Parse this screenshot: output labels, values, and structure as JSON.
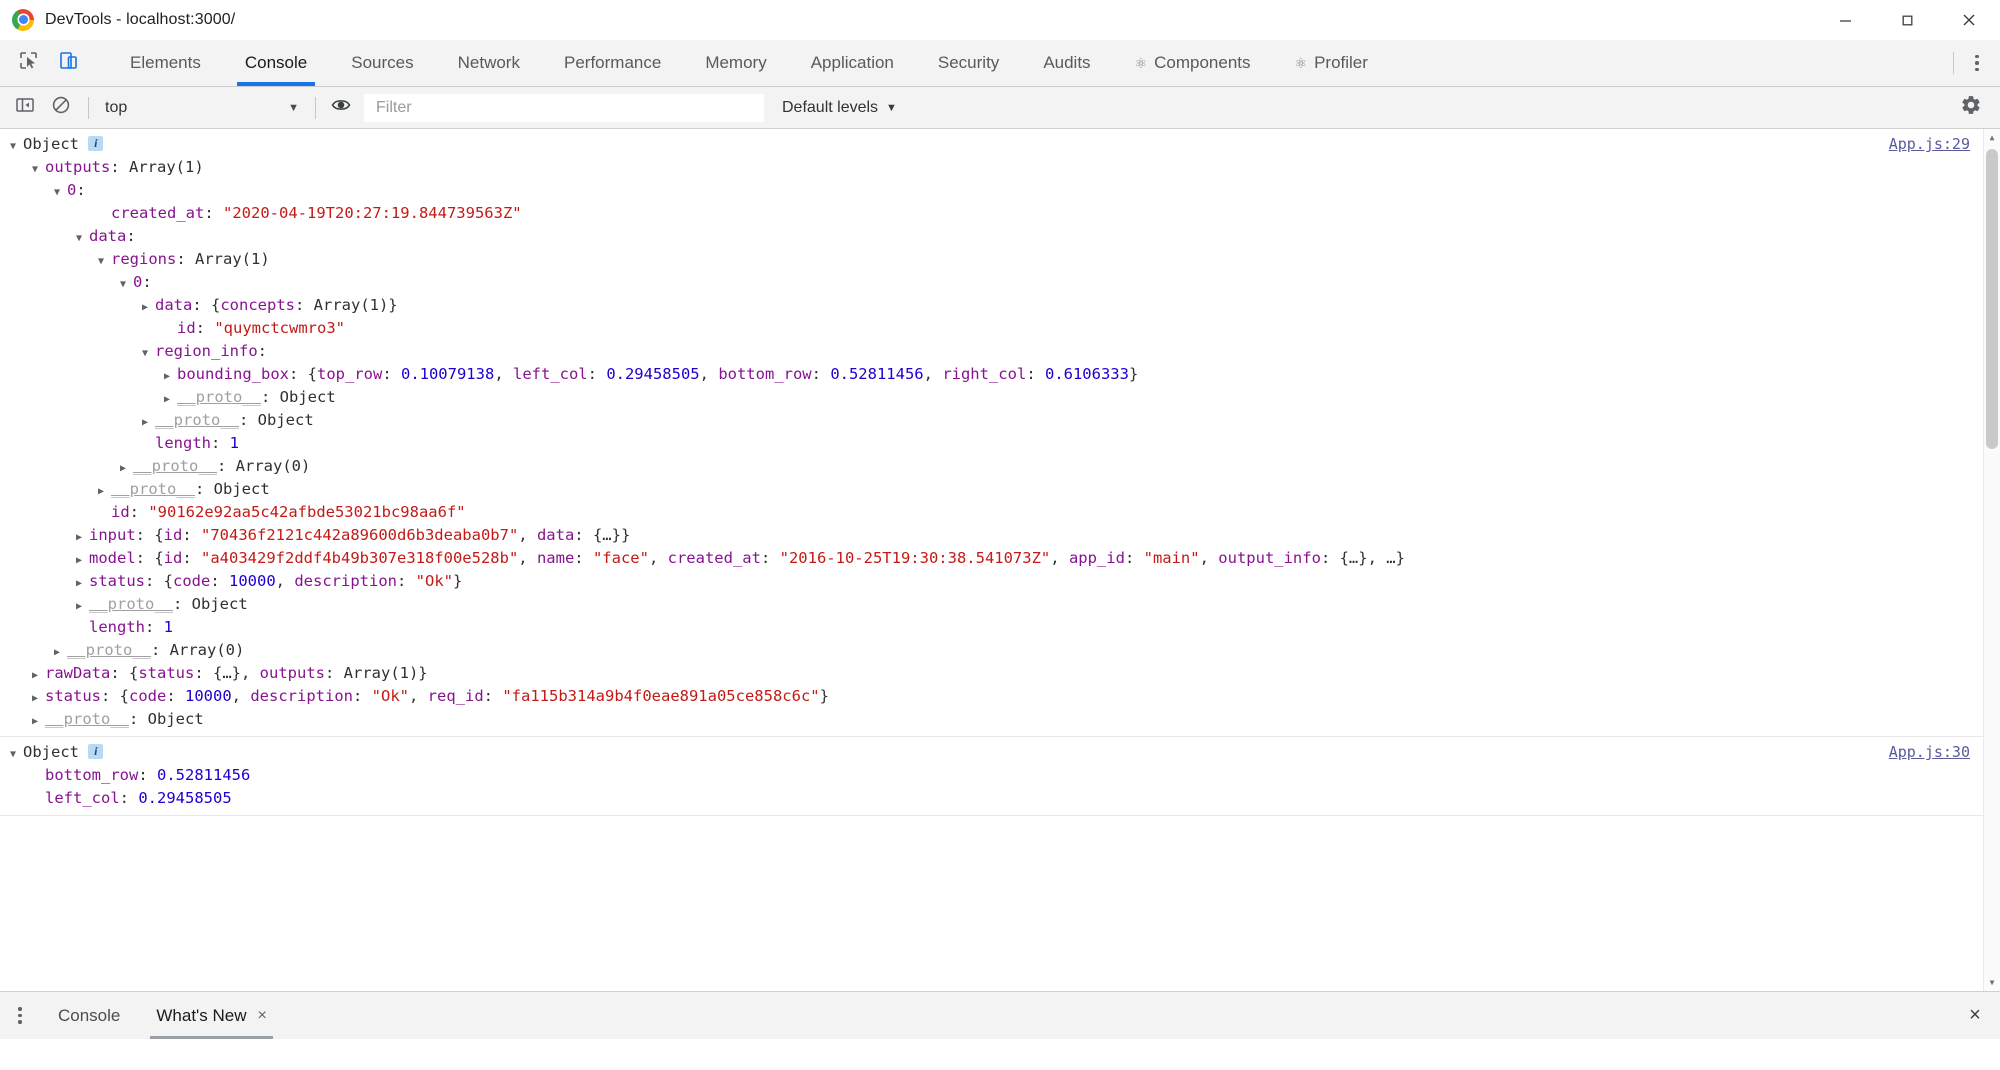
{
  "window": {
    "title": "DevTools - localhost:3000/",
    "logo_icon": "chrome-logo-icon",
    "minimize_icon": "minimize-icon",
    "maximize_icon": "maximize-icon",
    "close_icon": "close-icon"
  },
  "tabbar": {
    "inspect_icon": "inspect-element-icon",
    "device_icon": "toggle-device-toolbar-icon",
    "more_icon": "more-options-kebab-icon",
    "tabs": [
      {
        "label": "Elements",
        "selected": false,
        "react": false
      },
      {
        "label": "Console",
        "selected": true,
        "react": false
      },
      {
        "label": "Sources",
        "selected": false,
        "react": false
      },
      {
        "label": "Network",
        "selected": false,
        "react": false
      },
      {
        "label": "Performance",
        "selected": false,
        "react": false
      },
      {
        "label": "Memory",
        "selected": false,
        "react": false
      },
      {
        "label": "Application",
        "selected": false,
        "react": false
      },
      {
        "label": "Security",
        "selected": false,
        "react": false
      },
      {
        "label": "Audits",
        "selected": false,
        "react": false
      },
      {
        "label": "Components",
        "selected": false,
        "react": true
      },
      {
        "label": "Profiler",
        "selected": false,
        "react": true
      }
    ],
    "react_dot": "⚛"
  },
  "console_toolbar": {
    "sidebar_icon": "console-sidebar-icon",
    "clear_icon": "clear-console-icon",
    "context": "top",
    "caret": "▼",
    "eye_icon": "live-expression-eye-icon",
    "filter_placeholder": "Filter",
    "filter_value": "",
    "levels": "Default levels",
    "settings_icon": "settings-gear-icon"
  },
  "console": {
    "groups": [
      {
        "source": "App.js:29",
        "lines": [
          {
            "indent": 0,
            "tri": "open",
            "parts": [
              {
                "t": "Object ",
                "c": "plain"
              }
            ],
            "badge": true
          },
          {
            "indent": 1,
            "tri": "open",
            "parts": [
              {
                "t": "outputs",
                "c": "prop"
              },
              {
                "t": ": ",
                "c": "plain"
              },
              {
                "t": "Array(1)",
                "c": "plain"
              }
            ]
          },
          {
            "indent": 2,
            "tri": "open",
            "parts": [
              {
                "t": "0",
                "c": "prop"
              },
              {
                "t": ":",
                "c": "plain"
              }
            ]
          },
          {
            "indent": 4,
            "tri": "none",
            "parts": [
              {
                "t": "created_at",
                "c": "prop"
              },
              {
                "t": ": ",
                "c": "plain"
              },
              {
                "t": "\"2020-04-19T20:27:19.844739563Z\"",
                "c": "str"
              }
            ]
          },
          {
            "indent": 3,
            "tri": "open",
            "parts": [
              {
                "t": "data",
                "c": "prop"
              },
              {
                "t": ":",
                "c": "plain"
              }
            ]
          },
          {
            "indent": 4,
            "tri": "open",
            "parts": [
              {
                "t": "regions",
                "c": "prop"
              },
              {
                "t": ": ",
                "c": "plain"
              },
              {
                "t": "Array(1)",
                "c": "plain"
              }
            ]
          },
          {
            "indent": 5,
            "tri": "open",
            "parts": [
              {
                "t": "0",
                "c": "prop"
              },
              {
                "t": ":",
                "c": "plain"
              }
            ]
          },
          {
            "indent": 6,
            "tri": "closed",
            "parts": [
              {
                "t": "data",
                "c": "prop"
              },
              {
                "t": ": {",
                "c": "plain"
              },
              {
                "t": "concepts",
                "c": "prop"
              },
              {
                "t": ": ",
                "c": "plain"
              },
              {
                "t": "Array(1)}",
                "c": "plain"
              }
            ]
          },
          {
            "indent": 7,
            "tri": "none",
            "parts": [
              {
                "t": "id",
                "c": "prop"
              },
              {
                "t": ": ",
                "c": "plain"
              },
              {
                "t": "\"quymctcwmro3\"",
                "c": "str"
              }
            ]
          },
          {
            "indent": 6,
            "tri": "open",
            "parts": [
              {
                "t": "region_info",
                "c": "prop"
              },
              {
                "t": ":",
                "c": "plain"
              }
            ]
          },
          {
            "indent": 7,
            "tri": "closed",
            "parts": [
              {
                "t": "bounding_box",
                "c": "prop"
              },
              {
                "t": ": {",
                "c": "plain"
              },
              {
                "t": "top_row",
                "c": "prop"
              },
              {
                "t": ": ",
                "c": "plain"
              },
              {
                "t": "0.10079138",
                "c": "num"
              },
              {
                "t": ", ",
                "c": "plain"
              },
              {
                "t": "left_col",
                "c": "prop"
              },
              {
                "t": ": ",
                "c": "plain"
              },
              {
                "t": "0.29458505",
                "c": "num"
              },
              {
                "t": ", ",
                "c": "plain"
              },
              {
                "t": "bottom_row",
                "c": "prop"
              },
              {
                "t": ": ",
                "c": "plain"
              },
              {
                "t": "0.52811456",
                "c": "num"
              },
              {
                "t": ", ",
                "c": "plain"
              },
              {
                "t": "right_col",
                "c": "prop"
              },
              {
                "t": ": ",
                "c": "plain"
              },
              {
                "t": "0.6106333",
                "c": "num"
              },
              {
                "t": "}",
                "c": "plain"
              }
            ]
          },
          {
            "indent": 7,
            "tri": "closed",
            "parts": [
              {
                "t": "__proto__",
                "c": "proto"
              },
              {
                "t": ": ",
                "c": "plain"
              },
              {
                "t": "Object",
                "c": "plain"
              }
            ]
          },
          {
            "indent": 6,
            "tri": "closed",
            "parts": [
              {
                "t": "__proto__",
                "c": "proto"
              },
              {
                "t": ": ",
                "c": "plain"
              },
              {
                "t": "Object",
                "c": "plain"
              }
            ]
          },
          {
            "indent": 6,
            "tri": "none",
            "parts": [
              {
                "t": "length",
                "c": "prop"
              },
              {
                "t": ": ",
                "c": "plain"
              },
              {
                "t": "1",
                "c": "num"
              }
            ]
          },
          {
            "indent": 5,
            "tri": "closed",
            "parts": [
              {
                "t": "__proto__",
                "c": "proto"
              },
              {
                "t": ": ",
                "c": "plain"
              },
              {
                "t": "Array(0)",
                "c": "plain"
              }
            ]
          },
          {
            "indent": 4,
            "tri": "closed",
            "parts": [
              {
                "t": "__proto__",
                "c": "proto"
              },
              {
                "t": ": ",
                "c": "plain"
              },
              {
                "t": "Object",
                "c": "plain"
              }
            ]
          },
          {
            "indent": 4,
            "tri": "none",
            "parts": [
              {
                "t": "id",
                "c": "prop"
              },
              {
                "t": ": ",
                "c": "plain"
              },
              {
                "t": "\"90162e92aa5c42afbde53021bc98aa6f\"",
                "c": "str"
              }
            ]
          },
          {
            "indent": 3,
            "tri": "closed",
            "parts": [
              {
                "t": "input",
                "c": "prop"
              },
              {
                "t": ": {",
                "c": "plain"
              },
              {
                "t": "id",
                "c": "prop"
              },
              {
                "t": ": ",
                "c": "plain"
              },
              {
                "t": "\"70436f2121c442a89600d6b3deaba0b7\"",
                "c": "str"
              },
              {
                "t": ", ",
                "c": "plain"
              },
              {
                "t": "data",
                "c": "prop"
              },
              {
                "t": ": {…}}",
                "c": "plain"
              }
            ]
          },
          {
            "indent": 3,
            "tri": "closed",
            "parts": [
              {
                "t": "model",
                "c": "prop"
              },
              {
                "t": ": {",
                "c": "plain"
              },
              {
                "t": "id",
                "c": "prop"
              },
              {
                "t": ": ",
                "c": "plain"
              },
              {
                "t": "\"a403429f2ddf4b49b307e318f00e528b\"",
                "c": "str"
              },
              {
                "t": ", ",
                "c": "plain"
              },
              {
                "t": "name",
                "c": "prop"
              },
              {
                "t": ": ",
                "c": "plain"
              },
              {
                "t": "\"face\"",
                "c": "str"
              },
              {
                "t": ", ",
                "c": "plain"
              },
              {
                "t": "created_at",
                "c": "prop"
              },
              {
                "t": ": ",
                "c": "plain"
              },
              {
                "t": "\"2016-10-25T19:30:38.541073Z\"",
                "c": "str"
              },
              {
                "t": ", ",
                "c": "plain"
              },
              {
                "t": "app_id",
                "c": "prop"
              },
              {
                "t": ": ",
                "c": "plain"
              },
              {
                "t": "\"main\"",
                "c": "str"
              },
              {
                "t": ", ",
                "c": "plain"
              },
              {
                "t": "output_info",
                "c": "prop"
              },
              {
                "t": ": {…}, …}",
                "c": "plain"
              }
            ]
          },
          {
            "indent": 3,
            "tri": "closed",
            "parts": [
              {
                "t": "status",
                "c": "prop"
              },
              {
                "t": ": {",
                "c": "plain"
              },
              {
                "t": "code",
                "c": "prop"
              },
              {
                "t": ": ",
                "c": "plain"
              },
              {
                "t": "10000",
                "c": "num"
              },
              {
                "t": ", ",
                "c": "plain"
              },
              {
                "t": "description",
                "c": "prop"
              },
              {
                "t": ": ",
                "c": "plain"
              },
              {
                "t": "\"Ok\"",
                "c": "str"
              },
              {
                "t": "}",
                "c": "plain"
              }
            ]
          },
          {
            "indent": 3,
            "tri": "closed",
            "parts": [
              {
                "t": "__proto__",
                "c": "proto"
              },
              {
                "t": ": ",
                "c": "plain"
              },
              {
                "t": "Object",
                "c": "plain"
              }
            ]
          },
          {
            "indent": 3,
            "tri": "none",
            "parts": [
              {
                "t": "length",
                "c": "prop"
              },
              {
                "t": ": ",
                "c": "plain"
              },
              {
                "t": "1",
                "c": "num"
              }
            ]
          },
          {
            "indent": 2,
            "tri": "closed",
            "parts": [
              {
                "t": "__proto__",
                "c": "proto"
              },
              {
                "t": ": ",
                "c": "plain"
              },
              {
                "t": "Array(0)",
                "c": "plain"
              }
            ]
          },
          {
            "indent": 1,
            "tri": "closed",
            "parts": [
              {
                "t": "rawData",
                "c": "prop"
              },
              {
                "t": ": {",
                "c": "plain"
              },
              {
                "t": "status",
                "c": "prop"
              },
              {
                "t": ": {…}, ",
                "c": "plain"
              },
              {
                "t": "outputs",
                "c": "prop"
              },
              {
                "t": ": ",
                "c": "plain"
              },
              {
                "t": "Array(1)}",
                "c": "plain"
              }
            ]
          },
          {
            "indent": 1,
            "tri": "closed",
            "parts": [
              {
                "t": "status",
                "c": "prop"
              },
              {
                "t": ": {",
                "c": "plain"
              },
              {
                "t": "code",
                "c": "prop"
              },
              {
                "t": ": ",
                "c": "plain"
              },
              {
                "t": "10000",
                "c": "num"
              },
              {
                "t": ", ",
                "c": "plain"
              },
              {
                "t": "description",
                "c": "prop"
              },
              {
                "t": ": ",
                "c": "plain"
              },
              {
                "t": "\"Ok\"",
                "c": "str"
              },
              {
                "t": ", ",
                "c": "plain"
              },
              {
                "t": "req_id",
                "c": "prop"
              },
              {
                "t": ": ",
                "c": "plain"
              },
              {
                "t": "\"fa115b314a9b4f0eae891a05ce858c6c\"",
                "c": "str"
              },
              {
                "t": "}",
                "c": "plain"
              }
            ]
          },
          {
            "indent": 1,
            "tri": "closed",
            "parts": [
              {
                "t": "__proto__",
                "c": "proto"
              },
              {
                "t": ": ",
                "c": "plain"
              },
              {
                "t": "Object",
                "c": "plain"
              }
            ]
          }
        ]
      },
      {
        "source": "App.js:30",
        "lines": [
          {
            "indent": 0,
            "tri": "open",
            "parts": [
              {
                "t": "Object ",
                "c": "plain"
              }
            ],
            "badge": true
          },
          {
            "indent": 1,
            "tri": "none",
            "parts": [
              {
                "t": "bottom_row",
                "c": "prop"
              },
              {
                "t": ": ",
                "c": "plain"
              },
              {
                "t": "0.52811456",
                "c": "num"
              }
            ]
          },
          {
            "indent": 1,
            "tri": "none",
            "parts": [
              {
                "t": "left_col",
                "c": "prop"
              },
              {
                "t": ": ",
                "c": "plain"
              },
              {
                "t": "0.29458505",
                "c": "num"
              }
            ]
          }
        ]
      }
    ],
    "info_badge_char": "i"
  },
  "drawer": {
    "kebab_icon": "drawer-more-kebab-icon",
    "tabs": [
      {
        "label": "Console",
        "selected": false,
        "closable": false
      },
      {
        "label": "What's New",
        "selected": true,
        "closable": true
      }
    ],
    "close_char": "×",
    "close_drawer_icon": "close-drawer-icon",
    "close_drawer_char": "×"
  },
  "scrollbar": {
    "up_arrow": "▲",
    "down_arrow": "▼"
  }
}
